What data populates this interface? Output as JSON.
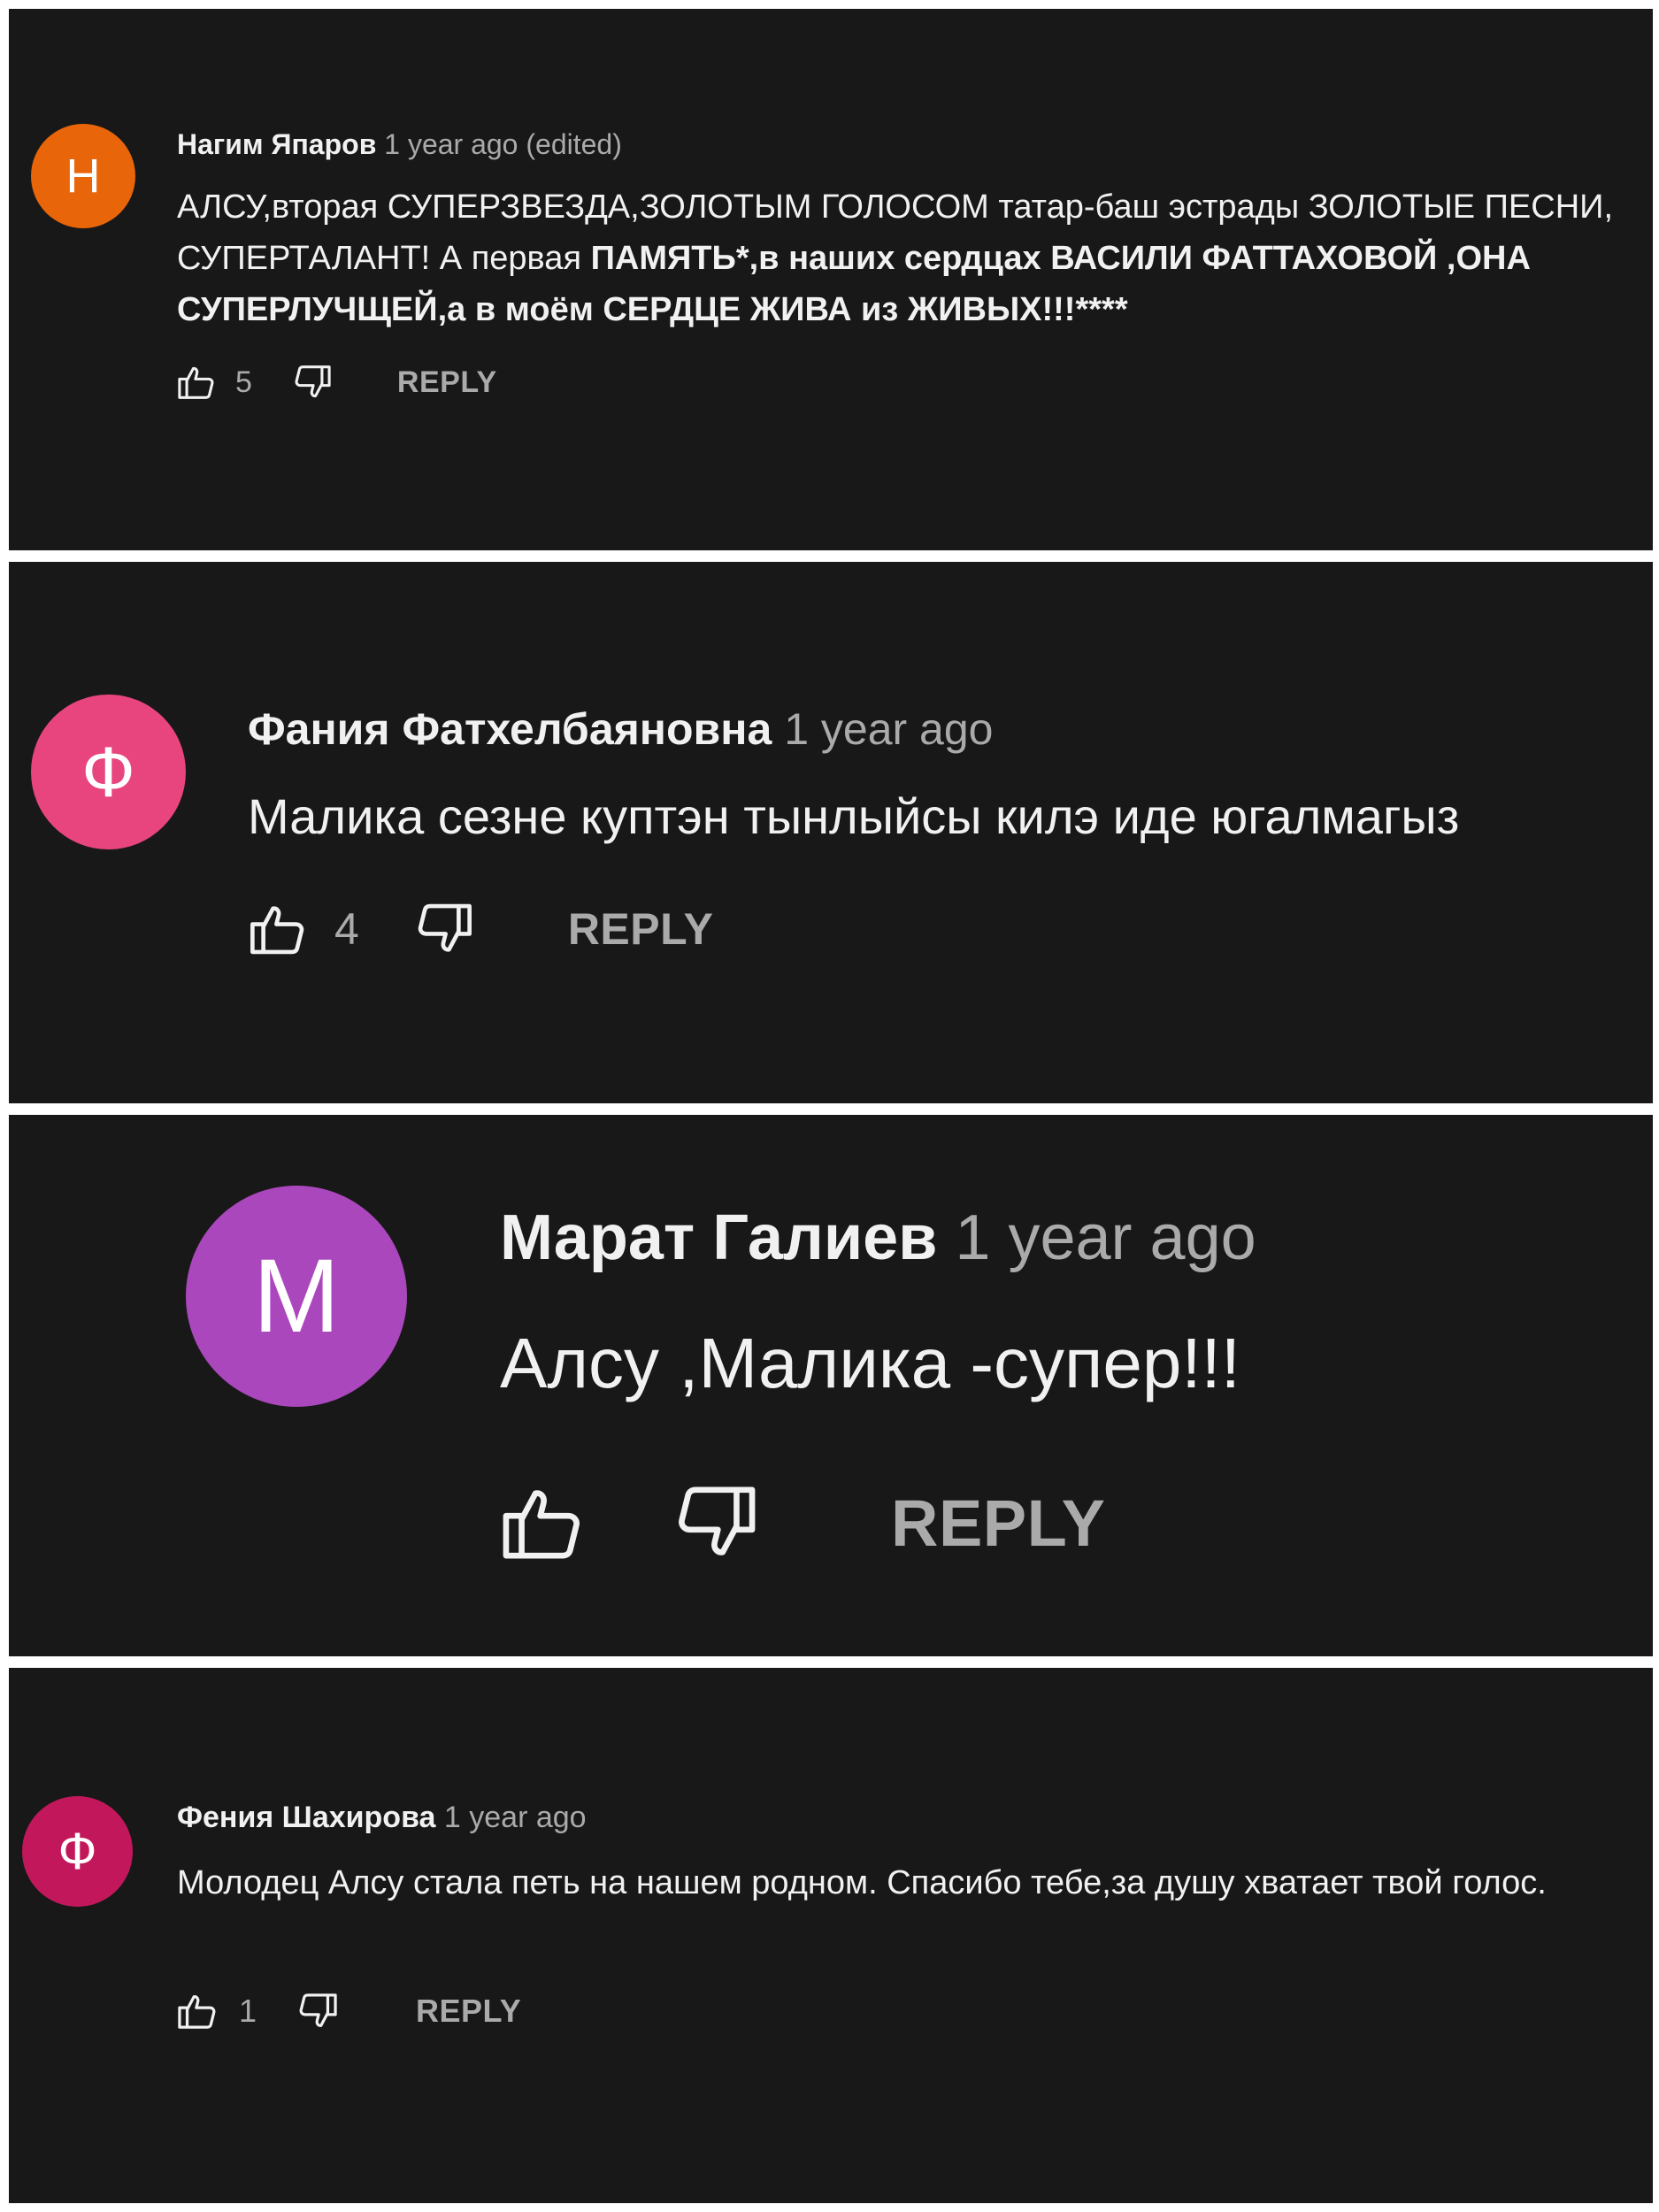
{
  "comments": [
    {
      "author": "Нагим Япаров",
      "time": "1 year ago (edited)",
      "avatar_letter": "Н",
      "avatar_color": "#e8650a",
      "text_runs": [
        "АЛСУ,вторая СУПЕРЗВЕЗДА,ЗОЛОТЫМ ГОЛОСОМ татар-баш эстрады ЗОЛОТЫЕ ПЕСНИ, СУПЕРТАЛАНТ! А первая ",
        "ПАМЯТЬ*,в наших сердцах ВАСИЛИ ФАТТАХОВОЙ ,ОНА СУПЕРЛУЧЩЕЙ,а в моём СЕРДЦЕ ЖИВА из ЖИВЫХ!!!****"
      ],
      "likes": "5",
      "reply_label": "REPLY"
    },
    {
      "author": "Фания Фатхелбаяновна",
      "time": "1 year ago",
      "avatar_letter": "Ф",
      "avatar_color": "#e8457e",
      "text": "Малика сезне куптэн тынлыйсы килэ иде югалмагыз",
      "likes": "4",
      "reply_label": "REPLY"
    },
    {
      "author": "Марат Галиев",
      "time": "1 year ago",
      "avatar_letter": "M",
      "avatar_color": "#ab47bc",
      "text": "Алсу ,Малика -супер!!!",
      "reply_label": "REPLY"
    },
    {
      "author": "Фения Шахирова",
      "time": "1 year ago",
      "avatar_letter": "Ф",
      "avatar_color": "#c2185b",
      "text": "Молодец Алсу стала петь на нашем родном. Спасибо тебе,за душу хватает твой голос.",
      "likes": "1",
      "reply_label": "REPLY"
    }
  ],
  "icons": {
    "like": "thumbs-up-icon",
    "dislike": "thumbs-down-icon"
  }
}
